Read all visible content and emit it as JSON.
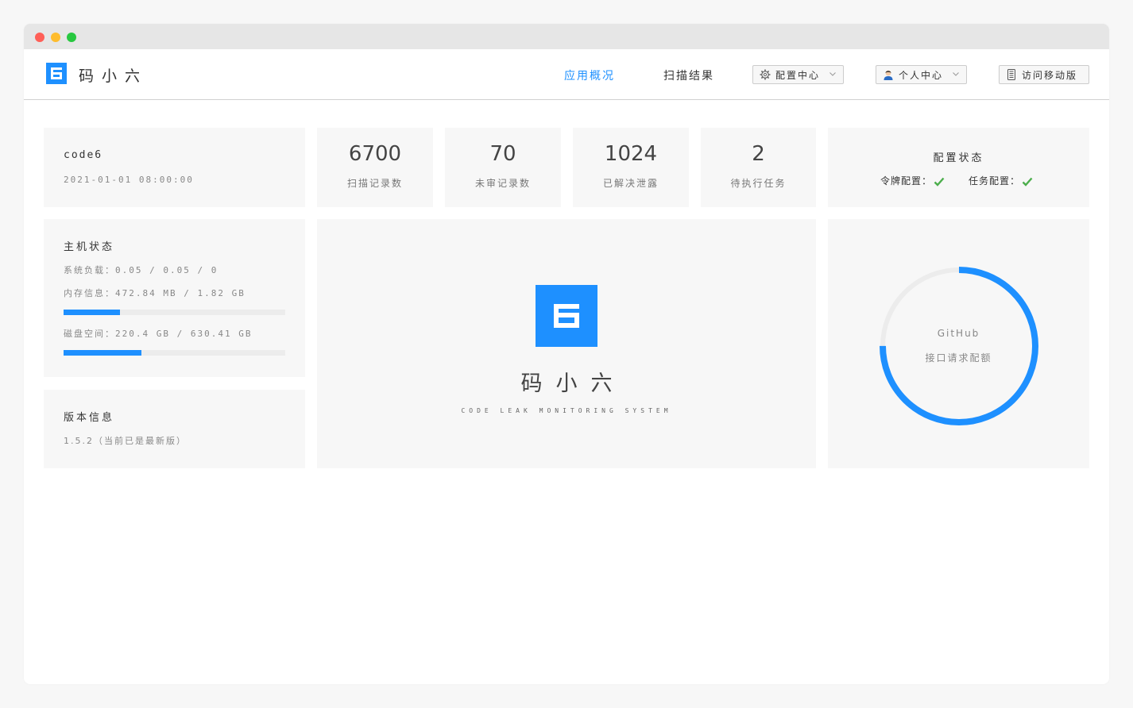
{
  "brand": {
    "name": "码小六",
    "tagline": "CODE LEAK MONITORING SYSTEM"
  },
  "nav": {
    "overview": "应用概况",
    "scan_results": "扫描结果",
    "config_center": "配置中心",
    "personal_center": "个人中心",
    "mobile": "访问移动版"
  },
  "user_card": {
    "username": "code6",
    "login_time": "2021-01-01 08:00:00"
  },
  "stats": [
    {
      "value": "6700",
      "label": "扫描记录数"
    },
    {
      "value": "70",
      "label": "未审记录数"
    },
    {
      "value": "1024",
      "label": "已解决泄露"
    },
    {
      "value": "2",
      "label": "待执行任务"
    }
  ],
  "config_status": {
    "title": "配置状态",
    "token_label": "令牌配置：",
    "task_label": "任务配置：",
    "token_ok": true,
    "task_ok": true
  },
  "host_status": {
    "title": "主机状态",
    "load_label": "系统负载：",
    "load_value": "0.05 / 0.05 / 0",
    "mem_label": "内存信息：",
    "mem_value": "472.84 MB / 1.82 GB",
    "mem_ratio": 0.254,
    "disk_label": "磁盘空间：",
    "disk_value": "220.4 GB / 630.41 GB",
    "disk_ratio": 0.35
  },
  "version": {
    "title": "版本信息",
    "text": "1.5.2（当前已是最新版）"
  },
  "quota": {
    "title": "GitHub",
    "subtitle": "接口请求配额",
    "ratio": 0.75
  },
  "colors": {
    "accent": "#1e90ff",
    "check": "#4cae4c",
    "card_bg": "#f7f7f7"
  },
  "icons": {
    "gear": "gear-icon",
    "user": "user-avatar-icon",
    "mobile": "mobile-icon",
    "chevron": "chevron-down-icon"
  }
}
